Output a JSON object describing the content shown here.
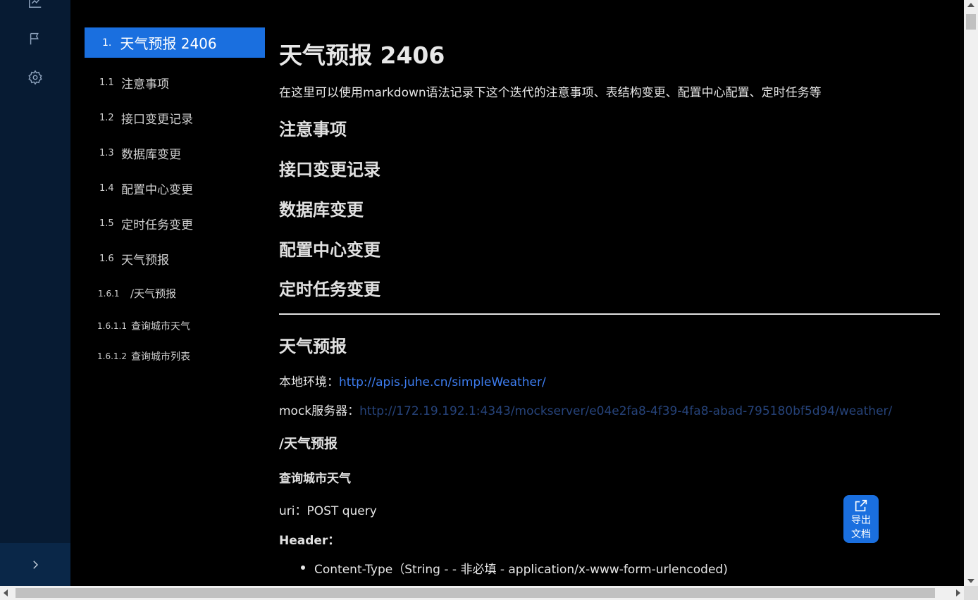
{
  "rail": {
    "icons": [
      "chart-icon",
      "flag-icon",
      "gear-icon"
    ],
    "expand_icon": "chevron-right-icon"
  },
  "toc": {
    "active": {
      "num": "1.",
      "label": "天气预报 2406"
    },
    "items": [
      {
        "num": "1.1",
        "label": "注意事项"
      },
      {
        "num": "1.2",
        "label": "接口变更记录"
      },
      {
        "num": "1.3",
        "label": "数据库变更"
      },
      {
        "num": "1.4",
        "label": "配置中心变更"
      },
      {
        "num": "1.5",
        "label": "定时任务变更"
      },
      {
        "num": "1.6",
        "label": "天气预报"
      },
      {
        "num": "1.6.1",
        "label": "/天气预报"
      },
      {
        "num": "1.6.1.1",
        "label": "查询城市天气"
      },
      {
        "num": "1.6.1.2",
        "label": "查询城市列表"
      }
    ]
  },
  "doc": {
    "title": "天气预报 2406",
    "intro": "在这里可以使用markdown语法记录下这个迭代的注意事项、表结构变更、配置中心配置、定时任务等",
    "sections": [
      "注意事项",
      "接口变更记录",
      "数据库变更",
      "配置中心变更",
      "定时任务变更"
    ],
    "weather_heading": "天气预报",
    "local_env_label": "本地环境：",
    "local_env_url": "http://apis.juhe.cn/simpleWeather/",
    "mock_label": "mock服务器：",
    "mock_url": "http://172.19.192.1:4343/mockserver/e04e2fa8-4f39-4fa8-abad-795180bf5d94/weather/",
    "path_heading": "/天气预报",
    "api_heading": "查询城市天气",
    "uri_text": "uri：POST query",
    "header_label": "Header：",
    "header_item": "Content-Type（String - - 非必填 - application/x-www-form-urlencoded)"
  },
  "export_button": {
    "icon": "external-link-icon",
    "line1": "导出",
    "line2": "文档"
  },
  "colors": {
    "accent": "#1a6fdf",
    "rail_bg": "#071b33",
    "link": "#3d7df0"
  }
}
